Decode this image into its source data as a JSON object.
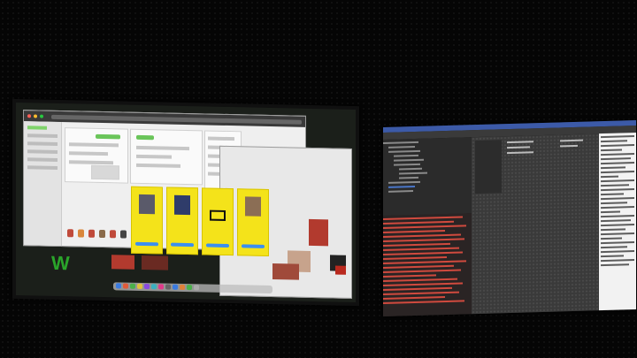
{
  "scene": {
    "description_hidden": false
  },
  "left_screen": {
    "browser": {
      "tab_title": "",
      "address": ""
    },
    "yellow_cards": [
      {
        "cta": ""
      },
      {
        "cta": ""
      },
      {
        "cta": ""
      },
      {
        "cta": ""
      }
    ],
    "logo_letter": "W"
  },
  "right_screen": {
    "app": "IDE",
    "console_status": "errors"
  },
  "colors": {
    "yellow": "#f4e31a",
    "green": "#6ac55a",
    "error_red": "#d04a3e",
    "ide_blue": "#3c5aa8"
  }
}
